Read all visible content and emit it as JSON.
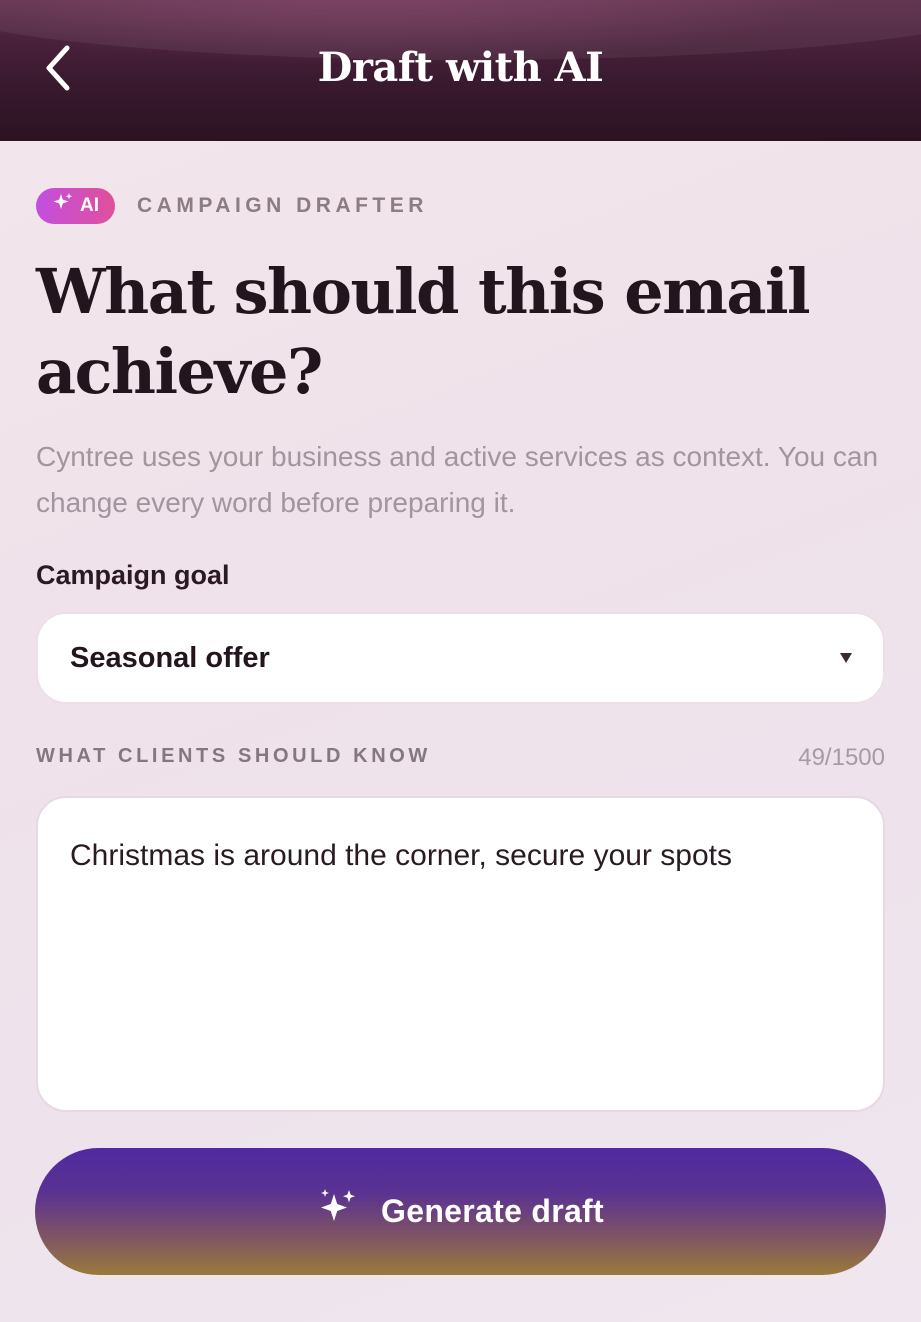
{
  "header": {
    "title": "Draft with AI",
    "back_icon": "chevron-left-icon"
  },
  "badge": {
    "label": "AI",
    "icon": "sparkles-icon",
    "eyebrow": "CAMPAIGN DRAFTER"
  },
  "headline": "What should this email achieve?",
  "subtext": "Cyntree uses your business and active services as context. You can change every word before preparing it.",
  "goal": {
    "label": "Campaign goal",
    "selected": "Seasonal offer"
  },
  "message": {
    "label": "WHAT CLIENTS SHOULD KNOW",
    "counter": "49/1500",
    "value": "Christmas is around the corner, secure your spots"
  },
  "generate": {
    "label": "Generate draft",
    "icon": "sparkles-icon"
  },
  "colors": {
    "header": "#3b1a30",
    "badge_start": "#c24fe0",
    "badge_end": "#e0509a",
    "button_top": "#4f2aa0",
    "button_bottom": "#9a7a3a"
  }
}
